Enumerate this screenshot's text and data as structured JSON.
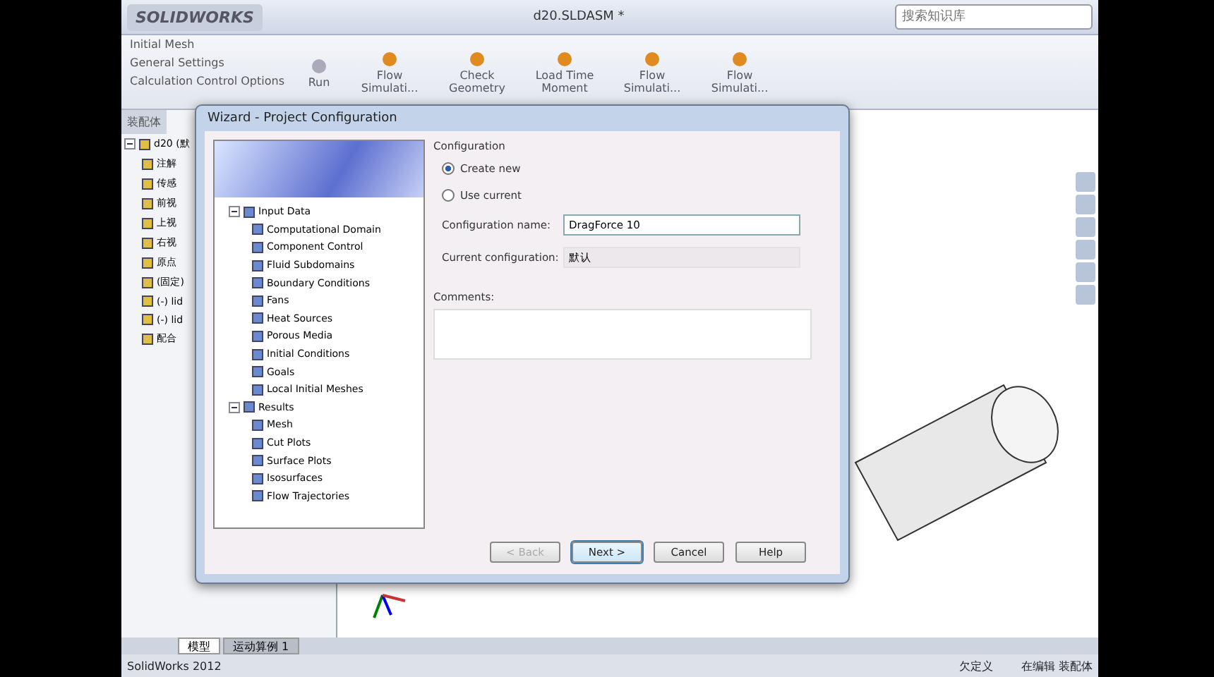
{
  "app": {
    "logo": "SOLIDWORKS",
    "document_title": "d20.SLDASM *",
    "search": {
      "placeholder": "搜索知识库"
    }
  },
  "ribbon": {
    "list": [
      "Initial Mesh",
      "General Settings",
      "Calculation Control Options"
    ],
    "buttons": [
      {
        "label": "Run",
        "kind": "small"
      },
      {
        "label": "Flow Simulati...",
        "kind": "large"
      },
      {
        "label": "Check Geometry",
        "kind": "large"
      },
      {
        "label": "Load Time Moment",
        "kind": "large"
      },
      {
        "label": "Flow Simulati...",
        "kind": "large"
      },
      {
        "label": "Flow Simulati...",
        "kind": "large"
      }
    ]
  },
  "left_panel": {
    "tab": "装配体",
    "tree": [
      {
        "label": "d20 (默",
        "expanded": true,
        "children": [
          {
            "label": "注解"
          },
          {
            "label": "传感"
          },
          {
            "label": "前视"
          },
          {
            "label": "上视"
          },
          {
            "label": "右视"
          },
          {
            "label": "原点"
          },
          {
            "label": "(固定)"
          },
          {
            "label": "(-) lid"
          },
          {
            "label": "(-) lid"
          },
          {
            "label": "配合"
          }
        ]
      }
    ]
  },
  "dialog": {
    "title": "Wizard - Project Configuration",
    "tree": [
      {
        "label": "Input Data",
        "expanded": true,
        "children": [
          {
            "label": "Computational Domain"
          },
          {
            "label": "Component Control"
          },
          {
            "label": "Fluid Subdomains"
          },
          {
            "label": "Boundary Conditions"
          },
          {
            "label": "Fans"
          },
          {
            "label": "Heat Sources"
          },
          {
            "label": "Porous Media"
          },
          {
            "label": "Initial Conditions"
          },
          {
            "label": "Goals"
          },
          {
            "label": "Local Initial Meshes"
          }
        ]
      },
      {
        "label": "Results",
        "expanded": true,
        "children": [
          {
            "label": "Mesh"
          },
          {
            "label": "Cut Plots"
          },
          {
            "label": "Surface Plots"
          },
          {
            "label": "Isosurfaces"
          },
          {
            "label": "Flow Trajectories"
          }
        ]
      }
    ],
    "group_title": "Configuration",
    "options": [
      {
        "label": "Create new",
        "selected": true
      },
      {
        "label": "Use current",
        "selected": false
      }
    ],
    "fields": [
      {
        "label": "Configuration name:",
        "value": "DragForce 10",
        "kind": "input"
      },
      {
        "label": "Current configuration:",
        "value": "默认",
        "kind": "readonly"
      }
    ],
    "comments_label": "Comments:",
    "buttons": [
      {
        "label": "< Back",
        "disabled": true,
        "selected": false
      },
      {
        "label": "Next >",
        "disabled": false,
        "selected": true
      },
      {
        "label": "Cancel",
        "disabled": false,
        "selected": false
      },
      {
        "label": "Help",
        "disabled": false,
        "selected": false
      }
    ]
  },
  "bottom_tabs": [
    {
      "label": "模型",
      "selected": true
    },
    {
      "label": "运动算例 1",
      "selected": false
    }
  ],
  "status_bar": [
    "SolidWorks 2012",
    "欠定义",
    "在编辑 装配体"
  ]
}
